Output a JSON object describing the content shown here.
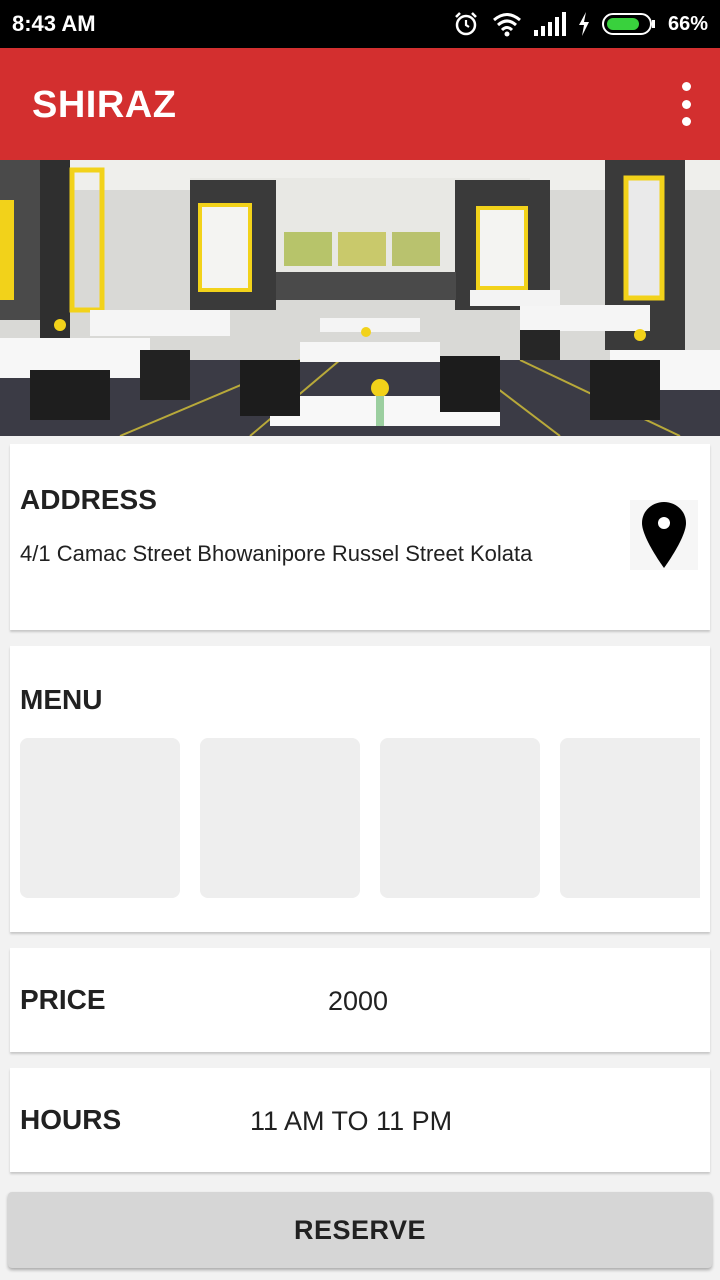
{
  "status_bar": {
    "time": "8:43 AM",
    "battery_percent": "66%",
    "icons": [
      "alarm-icon",
      "wifi-icon",
      "signal-icon",
      "charging-icon",
      "battery-icon"
    ]
  },
  "app_bar": {
    "title": "SHIRAZ",
    "overflow_icon": "more-vert-icon",
    "color": "#d32f2f"
  },
  "hero": {
    "image": "restaurant-interior-photo"
  },
  "address": {
    "label": "ADDRESS",
    "text": "4/1 Camac Street Bhowanipore Russel Street Kolata",
    "icon": "map-pin-icon"
  },
  "menu": {
    "label": "MENU",
    "thumbnail_count": 4
  },
  "price": {
    "label": "PRICE",
    "value": "2000"
  },
  "hours": {
    "label": "HOURS",
    "value": "11 AM TO 11 PM"
  },
  "reserve": {
    "label": "RESERVE"
  }
}
